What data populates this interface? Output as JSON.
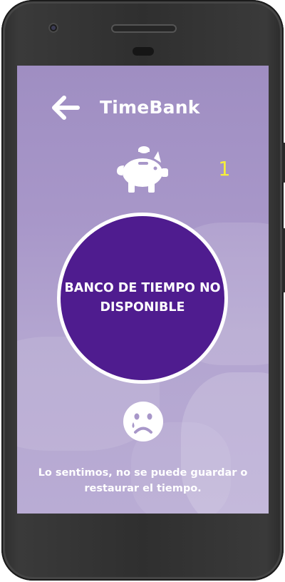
{
  "header": {
    "title": "TimeBank",
    "back_icon": "arrow-left-icon"
  },
  "piggy": {
    "icon": "piggy-bank-icon"
  },
  "counter": {
    "value": "1"
  },
  "status": {
    "text": "BANCO DE TIEMPO NO DISPONIBLE"
  },
  "sad": {
    "icon": "sad-face-icon"
  },
  "message": {
    "text": "Lo sentimos, no se puede guardar o restaurar el tiempo."
  },
  "colors": {
    "circle": "#4f1c8f",
    "background": "#a897c9",
    "counter": "#f6ef3a"
  }
}
